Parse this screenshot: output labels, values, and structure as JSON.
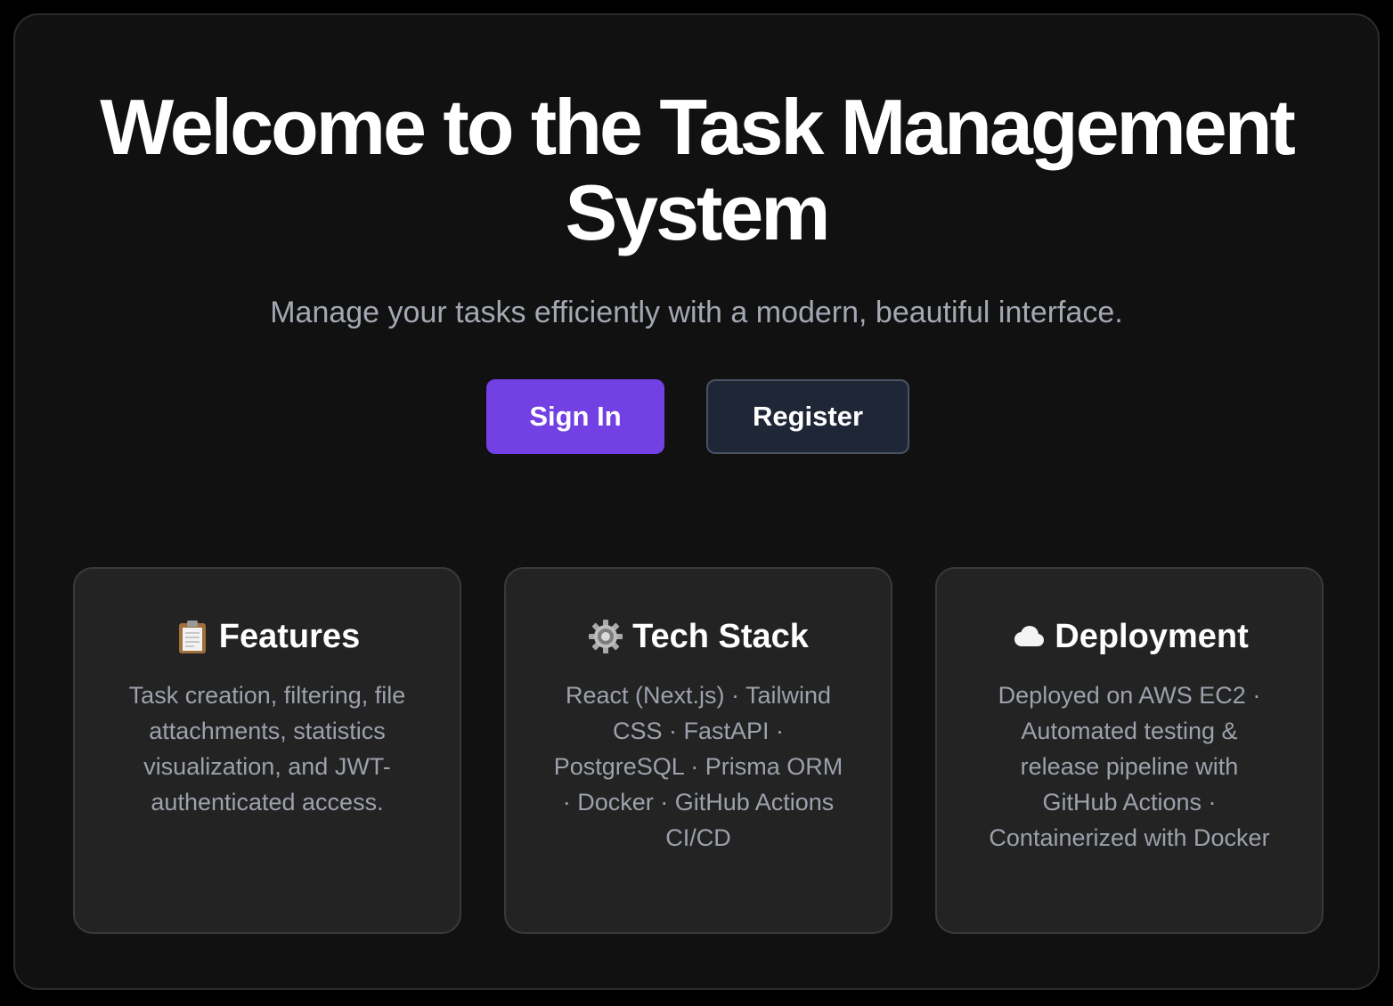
{
  "hero": {
    "title": "Welcome to the Task Management System",
    "subtitle": "Manage your tasks efficiently with a modern, beautiful interface."
  },
  "actions": {
    "sign_in_label": "Sign In",
    "register_label": "Register"
  },
  "cards": [
    {
      "icon": "clipboard-icon",
      "title": "Features",
      "text": "Task creation, filtering, file attachments, statistics visualization, and JWT-authenticated access."
    },
    {
      "icon": "gear-icon",
      "title": "Tech Stack",
      "text": "React (Next.js) · Tailwind CSS · FastAPI · PostgreSQL · Prisma ORM · Docker · GitHub Actions CI/CD"
    },
    {
      "icon": "cloud-icon",
      "title": "Deployment",
      "text": "Deployed on AWS EC2 · Automated testing & release pipeline with GitHub Actions · Containerized with Docker"
    }
  ],
  "colors": {
    "page_background": "#000000",
    "panel_background": "#111111",
    "primary_button": "#7340e3",
    "secondary_button": "#1f2636",
    "card_background": "#232323",
    "muted_text": "#9ca1ab"
  }
}
